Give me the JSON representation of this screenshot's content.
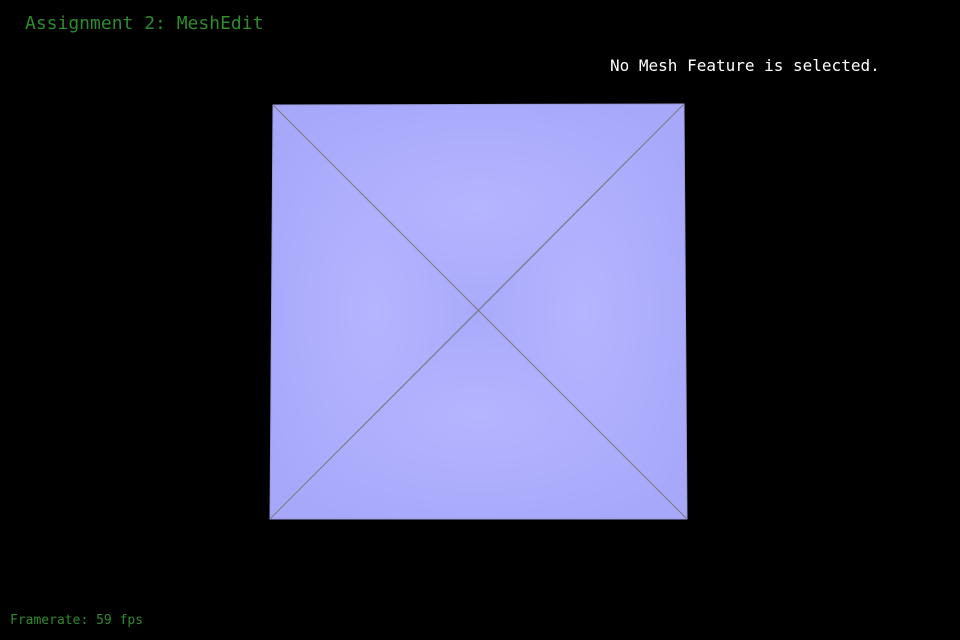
{
  "app": {
    "title": "Assignment 2: MeshEdit"
  },
  "status": {
    "message": "No Mesh Feature is selected."
  },
  "footer": {
    "framerate": "Framerate: 59 fps"
  },
  "colors": {
    "background": "#000000",
    "title_text": "#2e8b2e",
    "status_text": "#ffffff",
    "mesh_face": "#adadff",
    "mesh_edge": "#7a7a7a"
  }
}
